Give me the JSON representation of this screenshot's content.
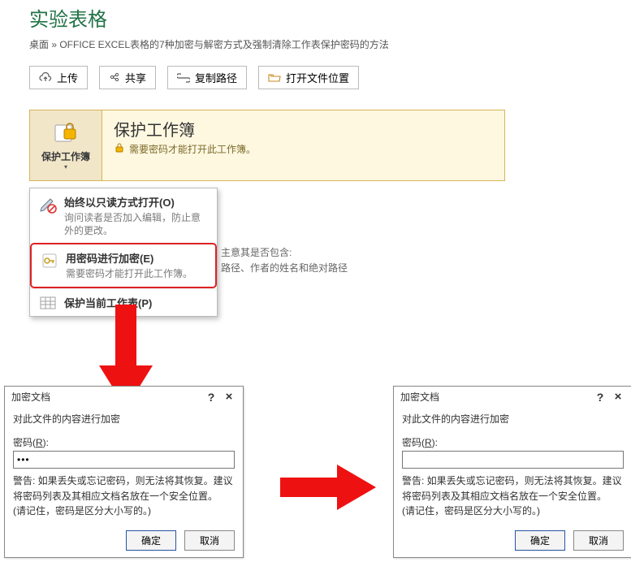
{
  "page_title": "实验表格",
  "breadcrumb": "桌面 » OFFICE EXCEL表格的7种加密与解密方式及强制清除工作表保护密码的方法",
  "toolbar": {
    "upload": "上传",
    "share": "共享",
    "copy_path": "复制路径",
    "open_loc": "打开文件位置"
  },
  "protect": {
    "button_label": "保护工作簿",
    "title": "保护工作簿",
    "desc": "需要密码才能打开此工作簿。"
  },
  "menu": {
    "readonly_title": "始终以只读方式打开(O)",
    "readonly_desc": "询问读者是否加入编辑，防止意外的更改。",
    "encrypt_title": "用密码进行加密(E)",
    "encrypt_desc": "需要密码才能打开此工作簿。",
    "protectsheet_title": "保护当前工作表(P)"
  },
  "peek": {
    "line1": "主意其是否包含:",
    "line2": "路径、作者的姓名和绝对路径"
  },
  "dialog": {
    "title": "加密文档",
    "heading": "对此文件的内容进行加密",
    "pwd_label_pre": "密码(",
    "pwd_label_u": "R",
    "pwd_label_post": "):",
    "pwd_value_left": "•••",
    "pwd_value_right": "",
    "warn": "警告: 如果丢失或忘记密码，则无法将其恢复。建议将密码列表及其相应文档名放在一个安全位置。\n(请记住，密码是区分大小写的。)",
    "ok": "确定",
    "cancel": "取消"
  }
}
